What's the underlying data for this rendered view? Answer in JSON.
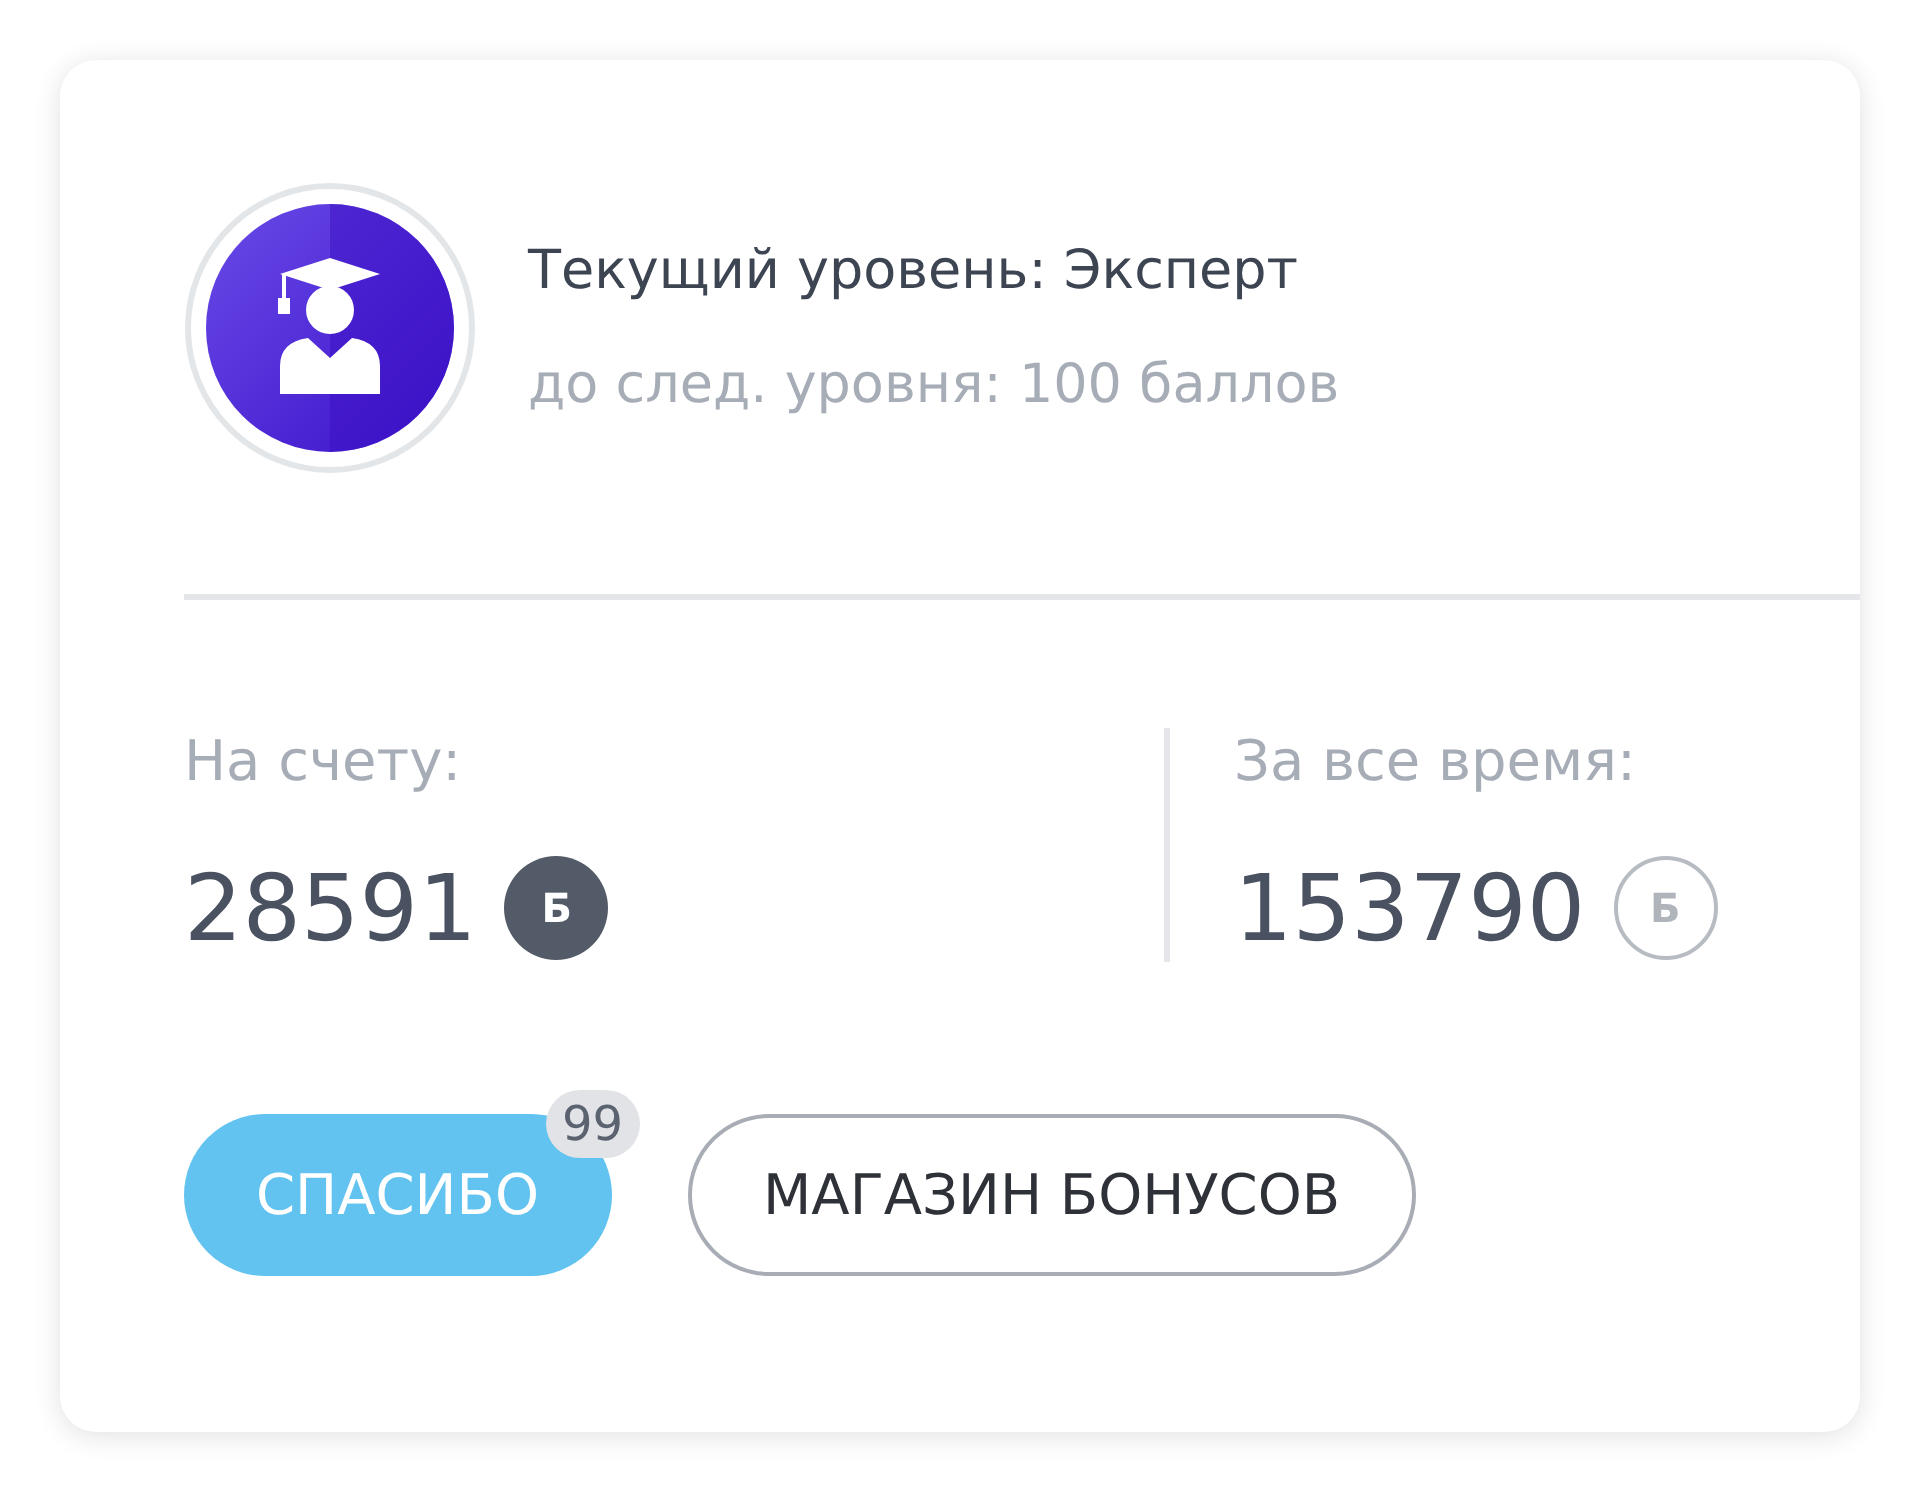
{
  "level": {
    "title": "Текущий уровень: Эксперт",
    "subtitle": "до след. уровня: 100 баллов"
  },
  "stats": [
    {
      "label": "На счету:",
      "value": "28591",
      "currency": "Б",
      "kind": "filled"
    },
    {
      "label": "За все время:",
      "value": "153790",
      "currency": "Б",
      "kind": "outline"
    }
  ],
  "buttons": [
    {
      "label": "СПАСИБО",
      "kind": "primary",
      "badge": "99"
    },
    {
      "label": "МАГАЗИН БОНУСОВ",
      "kind": "outline"
    }
  ]
}
